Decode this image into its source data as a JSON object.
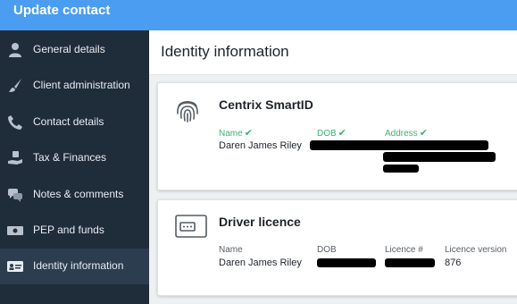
{
  "header": {
    "title": "Update contact"
  },
  "sidebar": {
    "items": [
      {
        "label": "General details",
        "icon": "person-icon"
      },
      {
        "label": "Client administration",
        "icon": "brush-icon"
      },
      {
        "label": "Contact details",
        "icon": "phone-icon"
      },
      {
        "label": "Tax & Finances",
        "icon": "hand-money-icon"
      },
      {
        "label": "Notes & comments",
        "icon": "chat-bubbles-icon"
      },
      {
        "label": "PEP and funds",
        "icon": "cash-icon"
      },
      {
        "label": "Identity information",
        "icon": "id-card-icon",
        "active": true
      }
    ]
  },
  "main": {
    "title": "Identity information",
    "cards": [
      {
        "title": "Centrix SmartID",
        "icon": "fingerprint-icon",
        "fields": [
          {
            "label": "Name",
            "verified": true,
            "value": "Daren James Riley"
          },
          {
            "label": "DOB",
            "verified": true,
            "value": ""
          },
          {
            "label": "Address",
            "verified": true,
            "value": ""
          }
        ]
      },
      {
        "title": "Driver licence",
        "icon": "licence-card-icon",
        "fields": [
          {
            "label": "Name",
            "value": "Daren James Riley"
          },
          {
            "label": "DOB",
            "value": ""
          },
          {
            "label": "Licence #",
            "value": ""
          },
          {
            "label": "Licence version",
            "value": "876"
          }
        ]
      }
    ]
  },
  "colors": {
    "topbar": "#4a9df0",
    "sidebar": "#1f2c3a",
    "sidebar_active": "#2c3d4f",
    "verified": "#3cb371"
  }
}
